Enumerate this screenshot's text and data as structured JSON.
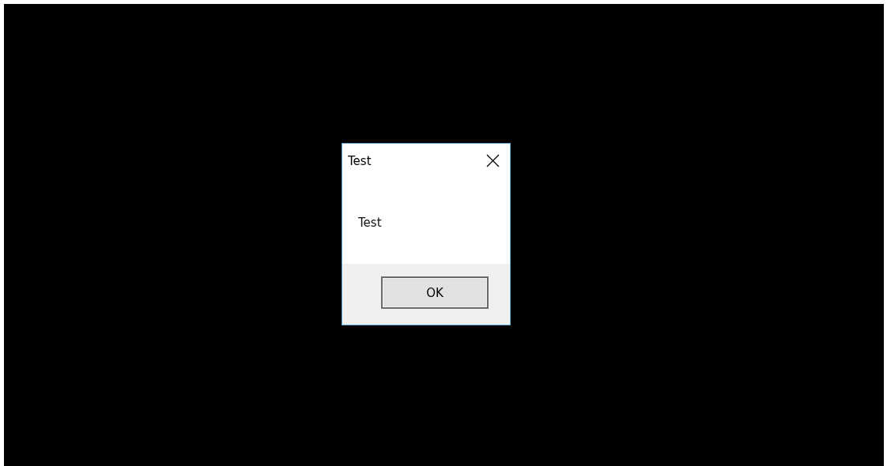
{
  "dialog": {
    "title": "Test",
    "message": "Test",
    "buttons": [
      "OK"
    ]
  }
}
